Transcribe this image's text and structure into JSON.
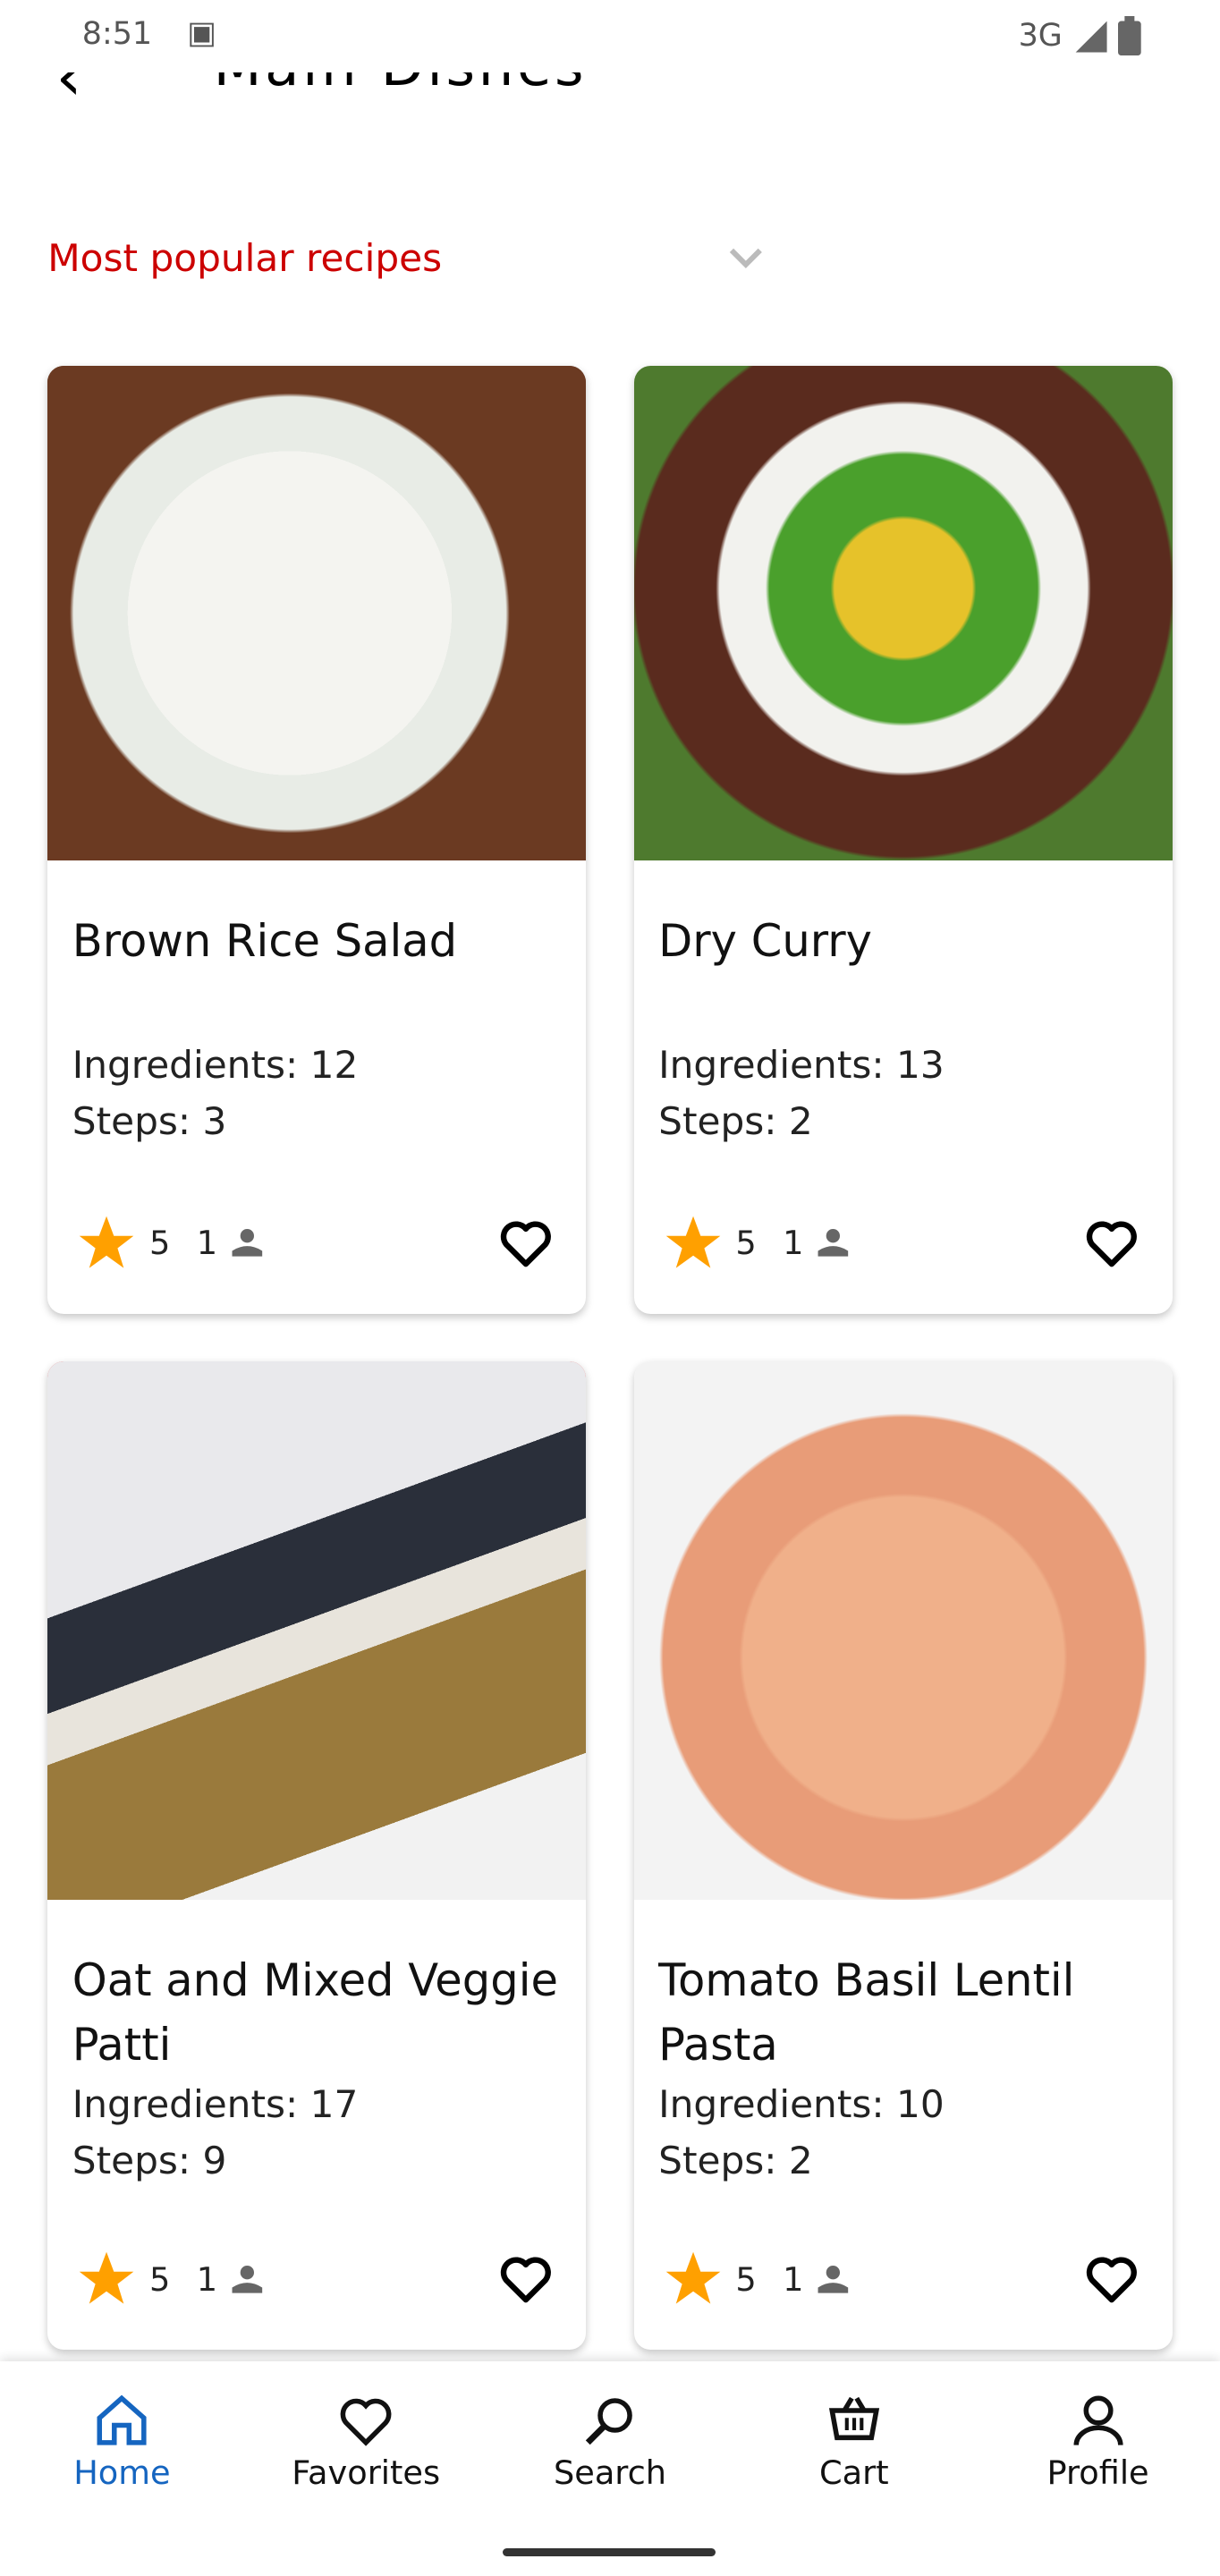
{
  "status_bar": {
    "time": "8:51",
    "network": "3G"
  },
  "header": {
    "title": "Main Dishes"
  },
  "section": {
    "title": "Most popular recipes"
  },
  "colors": {
    "accent": "#cc0000",
    "star": "#ffa000",
    "nav_active": "#1565c0"
  },
  "recipes": [
    {
      "name": "Brown Rice Salad",
      "ingredients": "Ingredients: 12",
      "steps": "Steps: 3",
      "rating": "5",
      "reviews": "1"
    },
    {
      "name": "Dry Curry",
      "ingredients": "Ingredients: 13",
      "steps": "Steps: 2",
      "rating": "5",
      "reviews": "1"
    },
    {
      "name": "Oat and Mixed Veggie Patti",
      "ingredients": "Ingredients: 17",
      "steps": "Steps: 9",
      "rating": "5",
      "reviews": "1"
    },
    {
      "name": "Tomato Basil Lentil Pasta",
      "ingredients": "Ingredients: 10",
      "steps": "Steps: 2",
      "rating": "5",
      "reviews": "1"
    }
  ],
  "nav": [
    {
      "label": "Home",
      "icon": "home-icon",
      "active": true
    },
    {
      "label": "Favorites",
      "icon": "heart-icon"
    },
    {
      "label": "Search",
      "icon": "search-icon"
    },
    {
      "label": "Cart",
      "icon": "cart-icon"
    },
    {
      "label": "Profile",
      "icon": "person-icon"
    }
  ]
}
